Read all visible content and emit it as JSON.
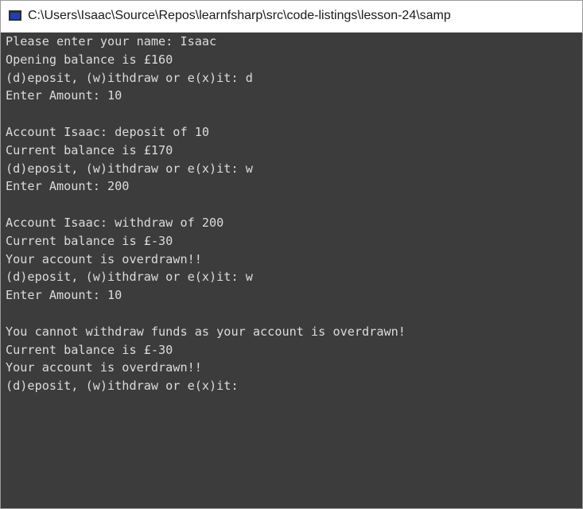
{
  "window": {
    "title": "C:\\Users\\Isaac\\Source\\Repos\\learnfsharp\\src\\code-listings\\lesson-24\\samp",
    "icon": "console-window-icon"
  },
  "console": {
    "lines": [
      "Please enter your name: Isaac",
      "Opening balance is £160",
      "(d)eposit, (w)ithdraw or e(x)it: d",
      "Enter Amount: 10",
      "",
      "Account Isaac: deposit of 10",
      "Current balance is £170",
      "(d)eposit, (w)ithdraw or e(x)it: w",
      "Enter Amount: 200",
      "",
      "Account Isaac: withdraw of 200",
      "Current balance is £-30",
      "Your account is overdrawn!!",
      "(d)eposit, (w)ithdraw or e(x)it: w",
      "Enter Amount: 10",
      "",
      "You cannot withdraw funds as your account is overdrawn!",
      "Current balance is £-30",
      "Your account is overdrawn!!",
      "(d)eposit, (w)ithdraw or e(x)it:"
    ]
  },
  "colors": {
    "console_background": "#3c3c3c",
    "console_text": "#dcdcdc",
    "titlebar_background": "#ffffff"
  }
}
